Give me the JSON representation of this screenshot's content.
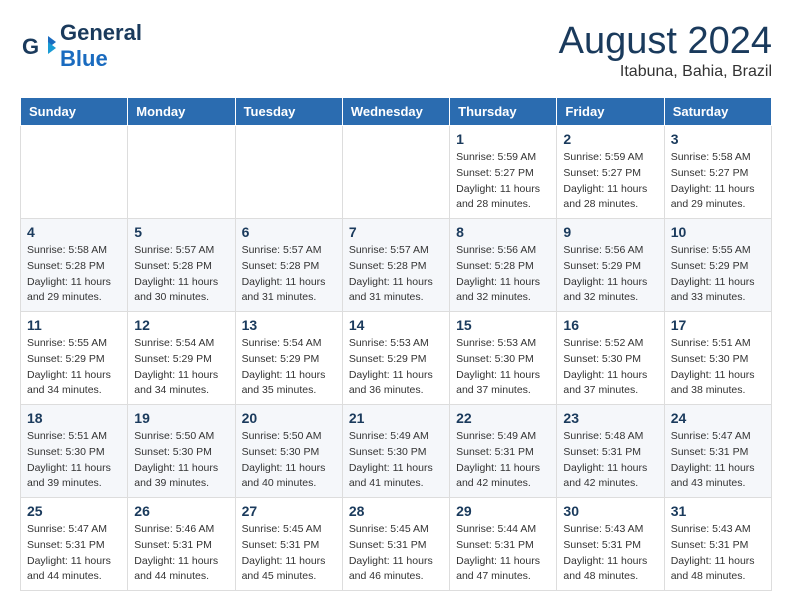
{
  "header": {
    "logo_general": "General",
    "logo_blue": "Blue",
    "month_title": "August 2024",
    "subtitle": "Itabuna, Bahia, Brazil"
  },
  "weekdays": [
    "Sunday",
    "Monday",
    "Tuesday",
    "Wednesday",
    "Thursday",
    "Friday",
    "Saturday"
  ],
  "weeks": [
    [
      {
        "day": "",
        "info": ""
      },
      {
        "day": "",
        "info": ""
      },
      {
        "day": "",
        "info": ""
      },
      {
        "day": "",
        "info": ""
      },
      {
        "day": "1",
        "info": "Sunrise: 5:59 AM\nSunset: 5:27 PM\nDaylight: 11 hours\nand 28 minutes."
      },
      {
        "day": "2",
        "info": "Sunrise: 5:59 AM\nSunset: 5:27 PM\nDaylight: 11 hours\nand 28 minutes."
      },
      {
        "day": "3",
        "info": "Sunrise: 5:58 AM\nSunset: 5:27 PM\nDaylight: 11 hours\nand 29 minutes."
      }
    ],
    [
      {
        "day": "4",
        "info": "Sunrise: 5:58 AM\nSunset: 5:28 PM\nDaylight: 11 hours\nand 29 minutes."
      },
      {
        "day": "5",
        "info": "Sunrise: 5:57 AM\nSunset: 5:28 PM\nDaylight: 11 hours\nand 30 minutes."
      },
      {
        "day": "6",
        "info": "Sunrise: 5:57 AM\nSunset: 5:28 PM\nDaylight: 11 hours\nand 31 minutes."
      },
      {
        "day": "7",
        "info": "Sunrise: 5:57 AM\nSunset: 5:28 PM\nDaylight: 11 hours\nand 31 minutes."
      },
      {
        "day": "8",
        "info": "Sunrise: 5:56 AM\nSunset: 5:28 PM\nDaylight: 11 hours\nand 32 minutes."
      },
      {
        "day": "9",
        "info": "Sunrise: 5:56 AM\nSunset: 5:29 PM\nDaylight: 11 hours\nand 32 minutes."
      },
      {
        "day": "10",
        "info": "Sunrise: 5:55 AM\nSunset: 5:29 PM\nDaylight: 11 hours\nand 33 minutes."
      }
    ],
    [
      {
        "day": "11",
        "info": "Sunrise: 5:55 AM\nSunset: 5:29 PM\nDaylight: 11 hours\nand 34 minutes."
      },
      {
        "day": "12",
        "info": "Sunrise: 5:54 AM\nSunset: 5:29 PM\nDaylight: 11 hours\nand 34 minutes."
      },
      {
        "day": "13",
        "info": "Sunrise: 5:54 AM\nSunset: 5:29 PM\nDaylight: 11 hours\nand 35 minutes."
      },
      {
        "day": "14",
        "info": "Sunrise: 5:53 AM\nSunset: 5:29 PM\nDaylight: 11 hours\nand 36 minutes."
      },
      {
        "day": "15",
        "info": "Sunrise: 5:53 AM\nSunset: 5:30 PM\nDaylight: 11 hours\nand 37 minutes."
      },
      {
        "day": "16",
        "info": "Sunrise: 5:52 AM\nSunset: 5:30 PM\nDaylight: 11 hours\nand 37 minutes."
      },
      {
        "day": "17",
        "info": "Sunrise: 5:51 AM\nSunset: 5:30 PM\nDaylight: 11 hours\nand 38 minutes."
      }
    ],
    [
      {
        "day": "18",
        "info": "Sunrise: 5:51 AM\nSunset: 5:30 PM\nDaylight: 11 hours\nand 39 minutes."
      },
      {
        "day": "19",
        "info": "Sunrise: 5:50 AM\nSunset: 5:30 PM\nDaylight: 11 hours\nand 39 minutes."
      },
      {
        "day": "20",
        "info": "Sunrise: 5:50 AM\nSunset: 5:30 PM\nDaylight: 11 hours\nand 40 minutes."
      },
      {
        "day": "21",
        "info": "Sunrise: 5:49 AM\nSunset: 5:30 PM\nDaylight: 11 hours\nand 41 minutes."
      },
      {
        "day": "22",
        "info": "Sunrise: 5:49 AM\nSunset: 5:31 PM\nDaylight: 11 hours\nand 42 minutes."
      },
      {
        "day": "23",
        "info": "Sunrise: 5:48 AM\nSunset: 5:31 PM\nDaylight: 11 hours\nand 42 minutes."
      },
      {
        "day": "24",
        "info": "Sunrise: 5:47 AM\nSunset: 5:31 PM\nDaylight: 11 hours\nand 43 minutes."
      }
    ],
    [
      {
        "day": "25",
        "info": "Sunrise: 5:47 AM\nSunset: 5:31 PM\nDaylight: 11 hours\nand 44 minutes."
      },
      {
        "day": "26",
        "info": "Sunrise: 5:46 AM\nSunset: 5:31 PM\nDaylight: 11 hours\nand 44 minutes."
      },
      {
        "day": "27",
        "info": "Sunrise: 5:45 AM\nSunset: 5:31 PM\nDaylight: 11 hours\nand 45 minutes."
      },
      {
        "day": "28",
        "info": "Sunrise: 5:45 AM\nSunset: 5:31 PM\nDaylight: 11 hours\nand 46 minutes."
      },
      {
        "day": "29",
        "info": "Sunrise: 5:44 AM\nSunset: 5:31 PM\nDaylight: 11 hours\nand 47 minutes."
      },
      {
        "day": "30",
        "info": "Sunrise: 5:43 AM\nSunset: 5:31 PM\nDaylight: 11 hours\nand 48 minutes."
      },
      {
        "day": "31",
        "info": "Sunrise: 5:43 AM\nSunset: 5:31 PM\nDaylight: 11 hours\nand 48 minutes."
      }
    ]
  ]
}
